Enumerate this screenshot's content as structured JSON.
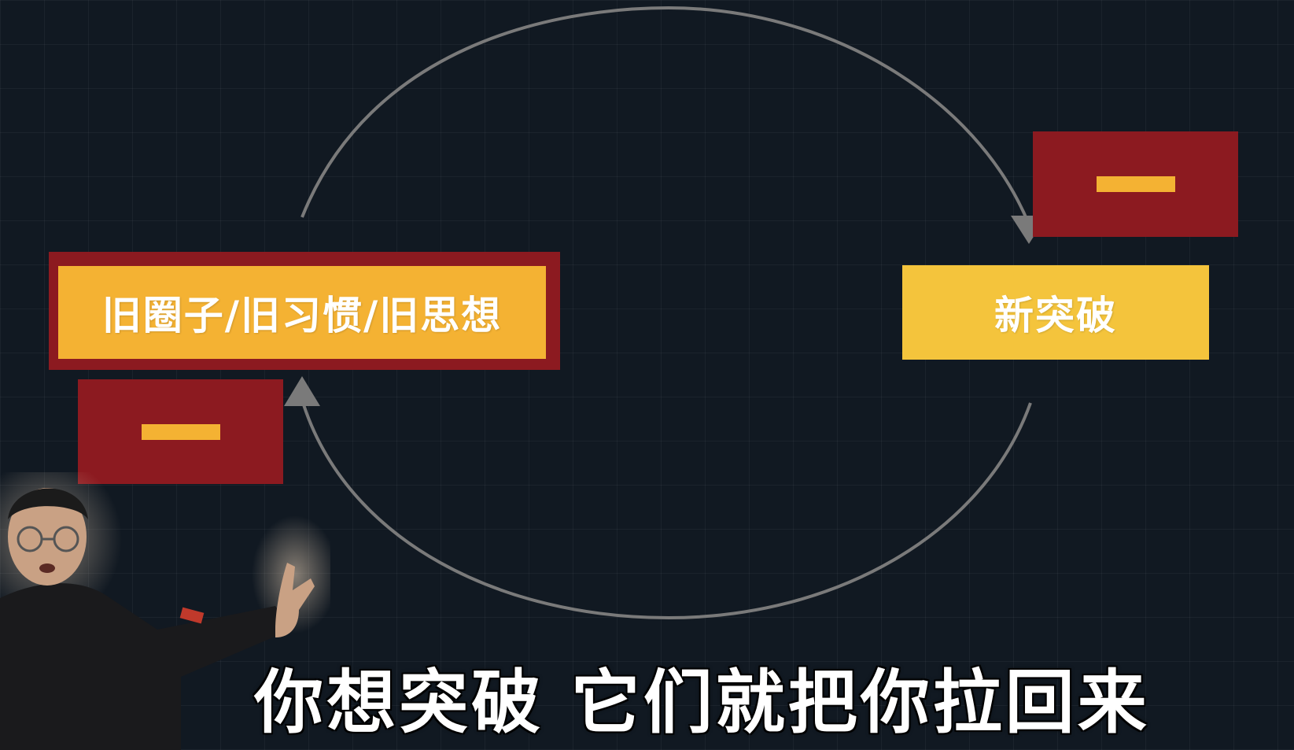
{
  "diagram": {
    "old_habits_label": "旧圈子/旧习惯/旧思想",
    "breakthrough_label": "新突破",
    "minus_sign_left": "—",
    "minus_sign_right": "—"
  },
  "subtitle": "你想突破 它们就把你拉回来",
  "colors": {
    "background": "#111922",
    "dark_red": "#8c1a20",
    "orange": "#f4b233",
    "yellow": "#f4c43c",
    "arrow": "#7a7a7a"
  }
}
